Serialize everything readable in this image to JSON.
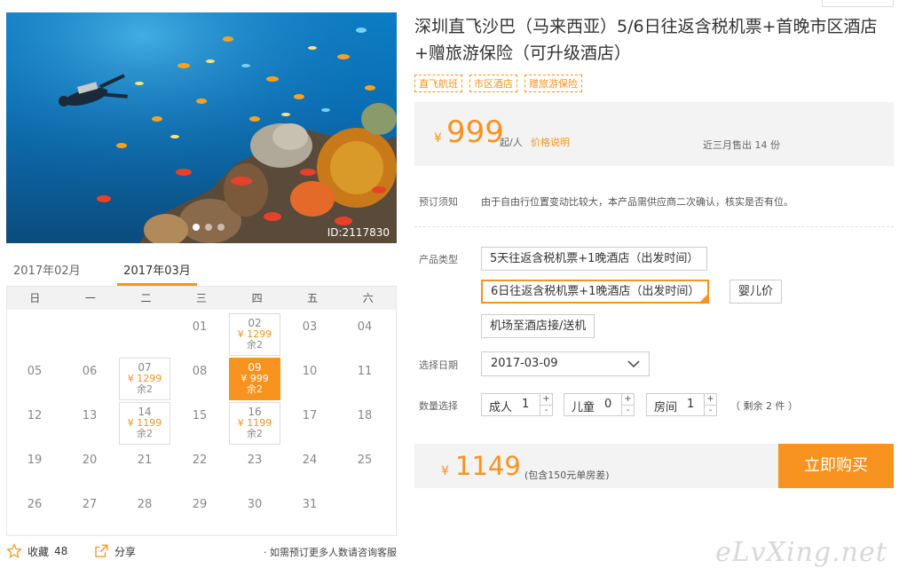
{
  "photo": {
    "id_label": "ID:2117830"
  },
  "calendar": {
    "prev_month": "2017年02月",
    "current_month": "2017年03月",
    "weekdays": [
      "日",
      "一",
      "二",
      "三",
      "四",
      "五",
      "六"
    ],
    "days": [
      {
        "day": "01"
      },
      {
        "day": "02",
        "price": "¥ 1299",
        "remain": "余2"
      },
      {
        "day": "03"
      },
      {
        "day": "04"
      },
      {
        "day": "05"
      },
      {
        "day": "06"
      },
      {
        "day": "07",
        "price": "¥ 1299",
        "remain": "余2"
      },
      {
        "day": "08"
      },
      {
        "day": "09",
        "price": "¥ 999",
        "remain": "余2",
        "selected": true
      },
      {
        "day": "10"
      },
      {
        "day": "11"
      },
      {
        "day": "12"
      },
      {
        "day": "13"
      },
      {
        "day": "14",
        "price": "¥ 1199",
        "remain": "余2"
      },
      {
        "day": "15"
      },
      {
        "day": "16",
        "price": "¥ 1199",
        "remain": "余2"
      },
      {
        "day": "17"
      },
      {
        "day": "18"
      },
      {
        "day": "19"
      },
      {
        "day": "20"
      },
      {
        "day": "21"
      },
      {
        "day": "22"
      },
      {
        "day": "23"
      },
      {
        "day": "24"
      },
      {
        "day": "25"
      },
      {
        "day": "26"
      },
      {
        "day": "27"
      },
      {
        "day": "28"
      },
      {
        "day": "29"
      },
      {
        "day": "30"
      },
      {
        "day": "31"
      }
    ]
  },
  "footer": {
    "favorite_label": "收藏",
    "favorite_count": "48",
    "share_label": "分享",
    "note": "· 如需预订更多人数请咨询客服"
  },
  "product": {
    "title": "深圳直飞沙巴（马来西亚）5/6日往返含税机票+首晚市区酒店+赠旅游保险（可升级酒店）",
    "tags": [
      "直飞航班",
      "市区酒店",
      "赠旅游保险"
    ],
    "price_symbol": "¥",
    "price": "999",
    "price_unit": "起/人",
    "price_note": "价格说明",
    "sold": "近三月售出 14 份"
  },
  "booking": {
    "notice_label": "预订须知",
    "notice_text": "由于自由行位置变动比较大，本产品需供应商二次确认，核实是否有位。",
    "type_label": "产品类型",
    "types": [
      "5天往返含税机票+1晚酒店（出发时间）",
      "6日往返含税机票+1晚酒店（出发时间）",
      "婴儿价",
      "机场至酒店接/送机"
    ],
    "date_label": "选择日期",
    "date_value": "2017-03-09",
    "qty_label": "数量选择",
    "adults_label": "成人",
    "adults_value": "1",
    "children_label": "儿童",
    "children_value": "0",
    "rooms_label": "房间",
    "rooms_value": "1",
    "plus": "+",
    "minus": "-",
    "remaining": "（ 剩余 2 件 ）"
  },
  "total": {
    "symbol": "¥",
    "amount": "1149",
    "include": "(包含150元单房差)",
    "buy_label": "立即购买"
  },
  "watermark": "eLvXing.net",
  "colors": {
    "accent": "#f7931e"
  }
}
